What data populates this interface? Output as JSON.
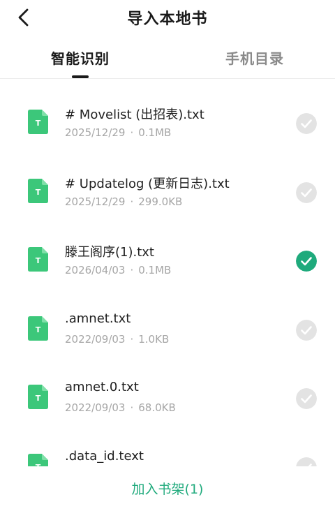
{
  "header": {
    "title": "导入本地书",
    "back_icon": "chevron-left-icon"
  },
  "tabs": [
    {
      "label": "智能识别",
      "active": true
    },
    {
      "label": "手机目录",
      "active": false
    }
  ],
  "colors": {
    "accent": "#1faa7c",
    "icon_green": "#3cc77a",
    "unchecked": "#e3e3e3"
  },
  "files": [
    {
      "name": "# Movelist (出招表).txt",
      "date": "2025/12/29",
      "size": "0.1MB",
      "selected": false,
      "icon": "txt-file-icon",
      "icon_letter": "T"
    },
    {
      "name": "# Updatelog (更新日志).txt",
      "date": "2025/12/29",
      "size": "299.0KB",
      "selected": false,
      "icon": "txt-file-icon",
      "icon_letter": "T"
    },
    {
      "name": "滕王阁序(1).txt",
      "date": "2026/04/03",
      "size": "0.1MB",
      "selected": true,
      "icon": "txt-file-icon",
      "icon_letter": "T"
    },
    {
      "name": ".amnet.txt",
      "date": "2022/09/03",
      "size": "1.0KB",
      "selected": false,
      "icon": "txt-file-icon",
      "icon_letter": "T"
    },
    {
      "name": "amnet.0.txt",
      "date": "2022/09/03",
      "size": "68.0KB",
      "selected": false,
      "icon": "txt-file-icon",
      "icon_letter": "T"
    },
    {
      "name": ".data_id.text",
      "date": "",
      "size": "",
      "selected": false,
      "icon": "txt-file-icon",
      "icon_letter": "T"
    }
  ],
  "meta_separator": "·",
  "footer": {
    "add_label": "加入书架(1)"
  }
}
